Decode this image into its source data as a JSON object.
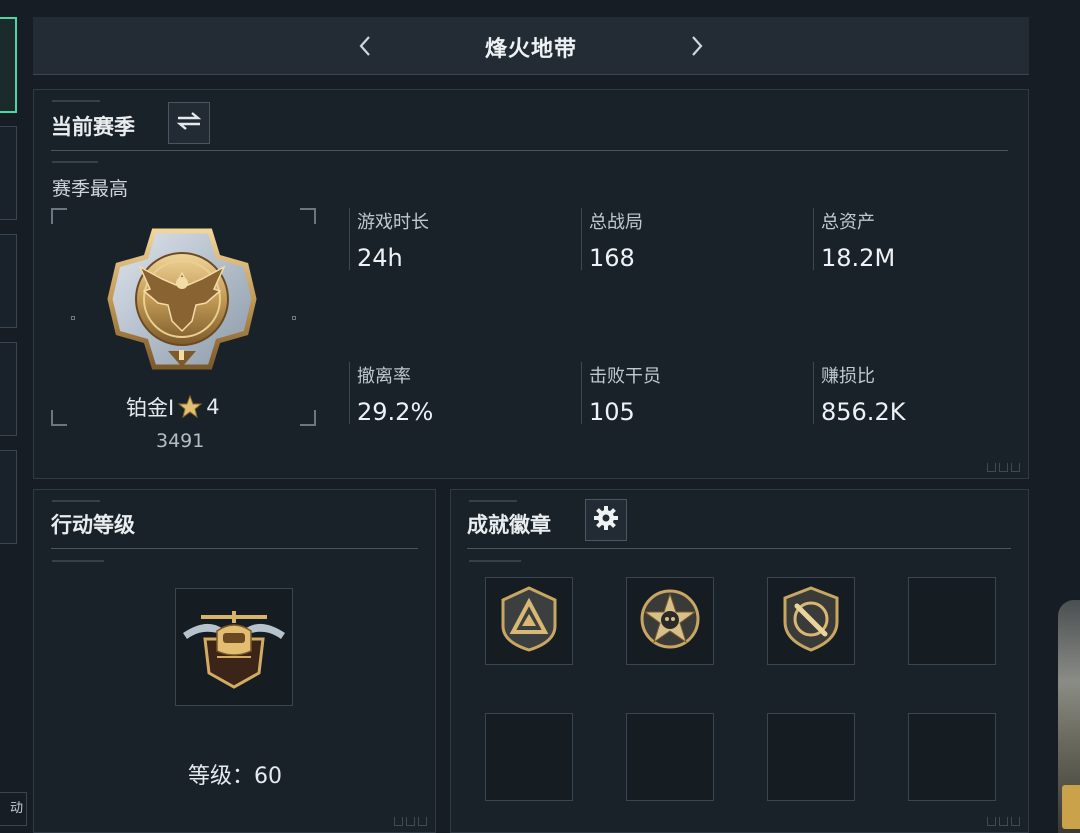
{
  "left_rail": {
    "bottom_label": "动"
  },
  "header": {
    "title": "烽火地带",
    "prev_icon": "chevron-left-icon",
    "next_icon": "chevron-right-icon"
  },
  "season": {
    "title": "当前赛季",
    "swap_icon": "swap-arrows-icon",
    "subtitle": "赛季最高",
    "rank": {
      "name": "铂金Ⅰ",
      "star_icon": "star-icon",
      "stars": "4",
      "score": "3491",
      "emblem": "eagle-medal-icon"
    },
    "stats": [
      {
        "label": "游戏时长",
        "value": "24h"
      },
      {
        "label": "总战局",
        "value": "168"
      },
      {
        "label": "总资产",
        "value": "18.2M"
      },
      {
        "label": "撤离率",
        "value": "29.2%"
      },
      {
        "label": "击败干员",
        "value": "105"
      },
      {
        "label": "赚损比",
        "value": "856.2K"
      }
    ]
  },
  "action_level": {
    "title": "行动等级",
    "emblem": "helicopter-badge-icon",
    "level_text": "等级：60"
  },
  "achievements": {
    "title": "成就徽章",
    "settings_icon": "gear-icon",
    "badges": [
      {
        "name": "triangle-shield-badge-icon",
        "filled": true
      },
      {
        "name": "star-skull-badge-icon",
        "filled": true
      },
      {
        "name": "knife-shield-badge-icon",
        "filled": true
      },
      {
        "name": "empty-slot",
        "filled": false
      },
      {
        "name": "empty-slot",
        "filled": false
      },
      {
        "name": "empty-slot",
        "filled": false
      },
      {
        "name": "empty-slot",
        "filled": false
      },
      {
        "name": "empty-slot",
        "filled": false
      }
    ]
  },
  "colors": {
    "accent": "#4fd6a0",
    "gold": "#c9a24a",
    "panel": "#1a2229",
    "background": "#161d24"
  }
}
